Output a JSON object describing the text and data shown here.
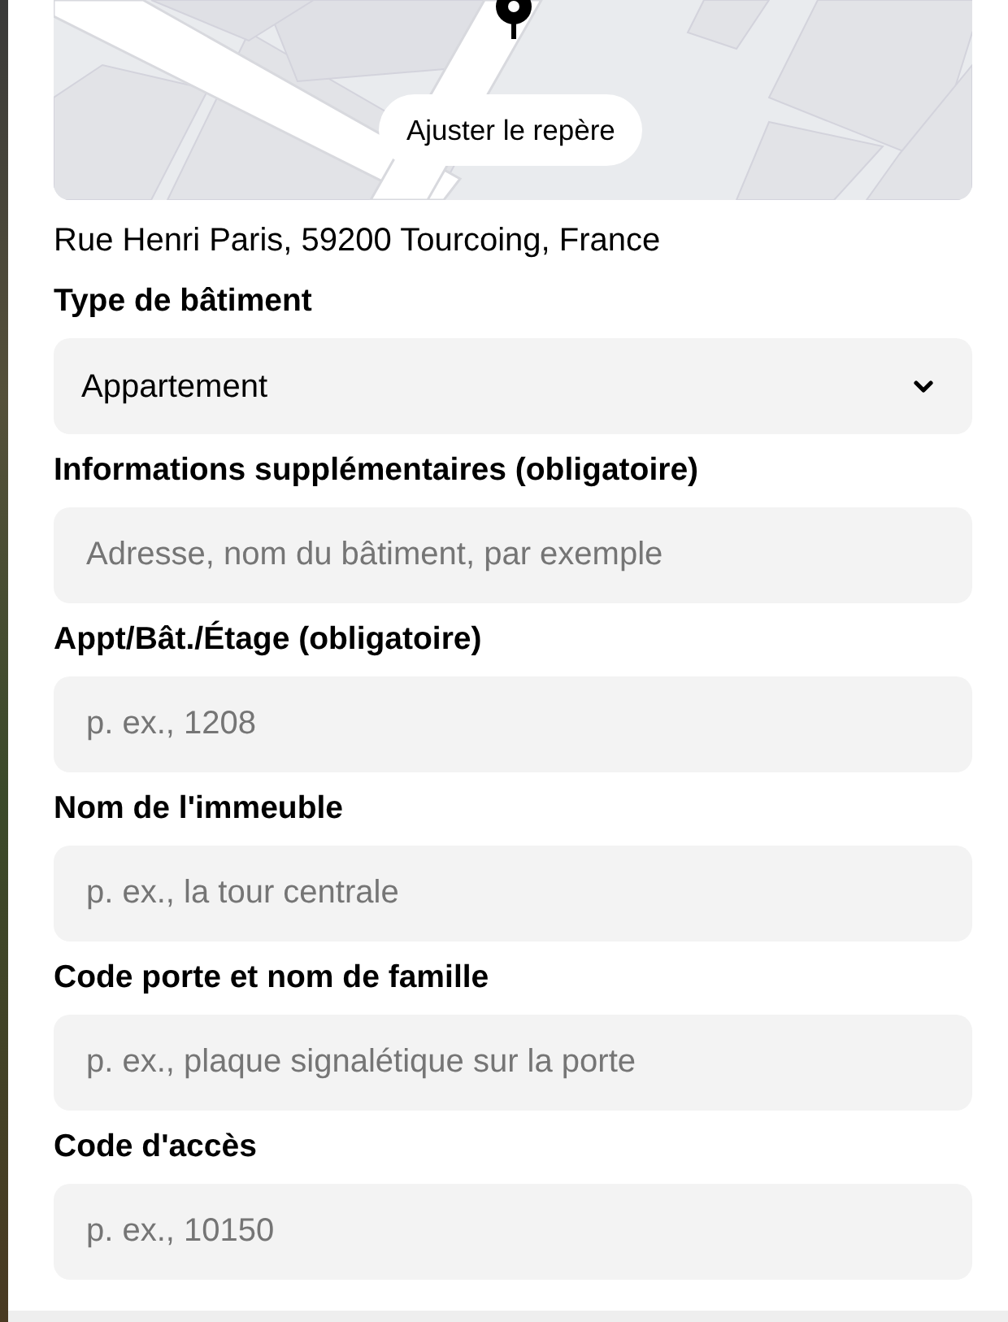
{
  "map": {
    "button": "Ajuster le repère"
  },
  "address": "Rue Henri Paris, 59200 Tourcoing, France",
  "fields": [
    {
      "kind": "select",
      "label": "Type de bâtiment",
      "value": "Appartement"
    },
    {
      "kind": "text",
      "label": "Informations supplémentaires (obligatoire)",
      "placeholder": "Adresse, nom du bâtiment, par exemple"
    },
    {
      "kind": "text",
      "label": "Appt/Bât./Étage (obligatoire)",
      "placeholder": "p. ex., 1208"
    },
    {
      "kind": "text",
      "label": "Nom de l'immeuble",
      "placeholder": "p. ex., la tour centrale"
    },
    {
      "kind": "text",
      "label": "Code porte et nom de famille",
      "placeholder": "p. ex., plaque signalétique sur la porte"
    },
    {
      "kind": "text",
      "label": "Code d'accès",
      "placeholder": "p. ex., 10150"
    }
  ]
}
